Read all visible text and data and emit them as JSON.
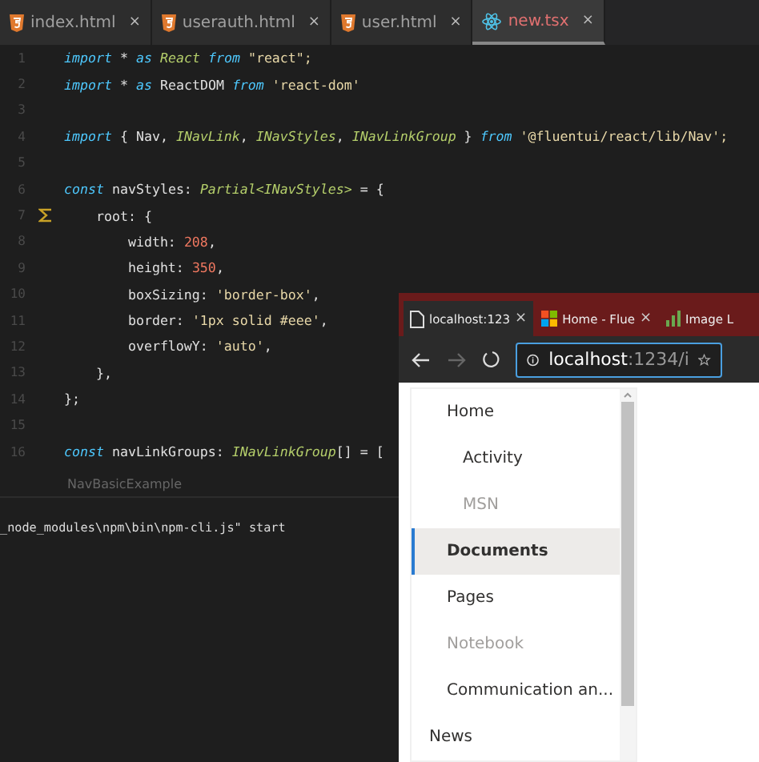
{
  "editor": {
    "tabs": [
      {
        "label": "index.html",
        "kind": "html",
        "close": "×",
        "selected": false
      },
      {
        "label": "userauth.html",
        "kind": "html",
        "close": "×",
        "selected": false
      },
      {
        "label": "user.html",
        "kind": "html",
        "close": "×",
        "selected": false
      },
      {
        "label": "new.tsx",
        "kind": "react",
        "close": "×",
        "selected": true
      }
    ],
    "lines": [
      {
        "number": "1",
        "tokens": [
          {
            "text": "import",
            "kind": "keyword"
          },
          {
            "text": " * ",
            "kind": "plain"
          },
          {
            "text": "as",
            "kind": "keyword"
          },
          {
            "text": " React",
            "kind": "type"
          },
          {
            "text": " from",
            "kind": "keyword"
          },
          {
            "text": " \"react\";",
            "kind": "string"
          }
        ]
      },
      {
        "number": "2",
        "tokens": [
          {
            "text": "import",
            "kind": "keyword"
          },
          {
            "text": " * ",
            "kind": "plain"
          },
          {
            "text": "as",
            "kind": "keyword"
          },
          {
            "text": " ReactDOM ",
            "kind": "plain"
          },
          {
            "text": "from",
            "kind": "keyword"
          },
          {
            "text": " 'react-dom'",
            "kind": "string"
          }
        ]
      },
      {
        "number": "3"
      },
      {
        "number": "4",
        "tokens": [
          {
            "text": "import",
            "kind": "keyword"
          },
          {
            "text": " { Nav, ",
            "kind": "plain"
          },
          {
            "text": "INavLink",
            "kind": "type"
          },
          {
            "text": ", ",
            "kind": "plain"
          },
          {
            "text": "INavStyles",
            "kind": "type"
          },
          {
            "text": ", ",
            "kind": "plain"
          },
          {
            "text": "INavLinkGroup",
            "kind": "type"
          },
          {
            "text": " } ",
            "kind": "plain"
          },
          {
            "text": "from",
            "kind": "keyword"
          },
          {
            "text": " '@fluentui/react/lib/Nav';",
            "kind": "string"
          }
        ]
      },
      {
        "number": "5"
      },
      {
        "number": "6",
        "tokens": [
          {
            "text": "const",
            "kind": "keyword"
          },
          {
            "text": " navStyles: ",
            "kind": "plain"
          },
          {
            "text": "Partial<INavStyles>",
            "kind": "type"
          },
          {
            "text": " = {",
            "kind": "plain"
          }
        ]
      },
      {
        "number": "7",
        "gutter_icon": true,
        "tokens": [
          {
            "text": "    root: {",
            "kind": "plain"
          }
        ]
      },
      {
        "number": "8",
        "tokens": [
          {
            "text": "        width: ",
            "kind": "plain"
          },
          {
            "text": "208",
            "kind": "number"
          },
          {
            "text": ",",
            "kind": "plain"
          }
        ]
      },
      {
        "number": "9",
        "tokens": [
          {
            "text": "        height: ",
            "kind": "plain"
          },
          {
            "text": "350",
            "kind": "number"
          },
          {
            "text": ",",
            "kind": "plain"
          }
        ]
      },
      {
        "number": "10",
        "tokens": [
          {
            "text": "        boxSizing: ",
            "kind": "plain"
          },
          {
            "text": "'border-box'",
            "kind": "string"
          },
          {
            "text": ",",
            "kind": "plain"
          }
        ]
      },
      {
        "number": "11",
        "tokens": [
          {
            "text": "        border: ",
            "kind": "plain"
          },
          {
            "text": "'1px solid #eee'",
            "kind": "string"
          },
          {
            "text": ",",
            "kind": "plain"
          }
        ]
      },
      {
        "number": "12",
        "tokens": [
          {
            "text": "        overflowY: ",
            "kind": "plain"
          },
          {
            "text": "'auto'",
            "kind": "string"
          },
          {
            "text": ",",
            "kind": "plain"
          }
        ]
      },
      {
        "number": "13",
        "tokens": [
          {
            "text": "    },",
            "kind": "plain"
          }
        ]
      },
      {
        "number": "14",
        "tokens": [
          {
            "text": "};",
            "kind": "plain"
          }
        ]
      },
      {
        "number": "15"
      },
      {
        "number": "16",
        "tokens": [
          {
            "text": "const",
            "kind": "keyword"
          },
          {
            "text": " navLinkGroups: ",
            "kind": "plain"
          },
          {
            "text": "INavLinkGroup",
            "kind": "type"
          },
          {
            "text": "[] = [",
            "kind": "plain"
          }
        ]
      }
    ],
    "breadcrumb": "NavBasicExample"
  },
  "terminal": {
    "lines": [
      "_node_modules\\npm\\bin\\npm-cli.js\" start"
    ]
  },
  "browser": {
    "tabs": [
      {
        "label": "localhost:123",
        "kind": "page",
        "close": "×",
        "selected": true
      },
      {
        "label": "Home - Flue",
        "kind": "windows",
        "close": "×",
        "selected": false
      },
      {
        "label": "Image L",
        "kind": "chart",
        "selected": false
      }
    ],
    "address": {
      "host": "localhost",
      "rest": ":1234/i"
    },
    "nav": [
      {
        "label": "Home",
        "kind": "link",
        "selected": false,
        "disabled": false,
        "children": [
          {
            "label": "Activity",
            "kind": "link",
            "selected": false,
            "disabled": false
          },
          {
            "label": "MSN",
            "kind": "link",
            "selected": false,
            "disabled": true
          }
        ]
      },
      {
        "label": "Documents",
        "kind": "link",
        "selected": true,
        "disabled": false
      },
      {
        "label": "Pages",
        "kind": "link",
        "selected": false,
        "disabled": false
      },
      {
        "label": "Notebook",
        "kind": "link",
        "selected": false,
        "disabled": true
      },
      {
        "label": "Communication an...",
        "kind": "link",
        "selected": false,
        "disabled": false
      },
      {
        "label": "News",
        "kind": "header",
        "selected": false,
        "disabled": false
      }
    ]
  }
}
